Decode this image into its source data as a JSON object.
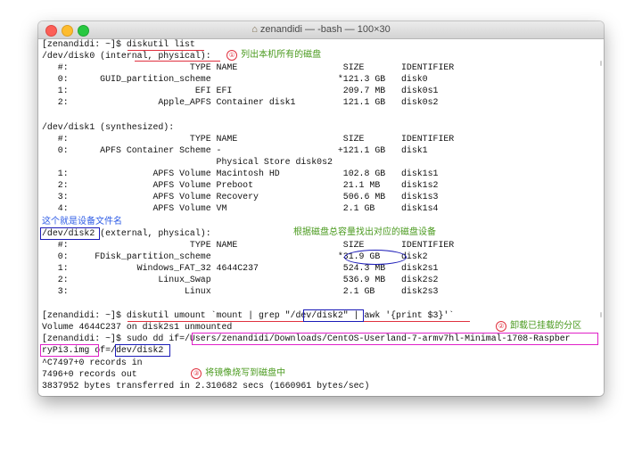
{
  "window": {
    "title": "zenandidi — -bash — 100×30"
  },
  "colors": {
    "note_red": "#e0313f",
    "note_green": "#4a9a1e",
    "note_blue": "#2e5ce6",
    "box_navy": "#1b1bb8",
    "box_magenta": "#e021c8"
  },
  "terminal": {
    "lines": [
      "[zenandidi: ~]$ diskutil list",
      "/dev/disk0 (internal, physical):",
      "   #:                       TYPE NAME                    SIZE       IDENTIFIER",
      "   0:      GUID_partition_scheme                        *121.3 GB   disk0",
      "   1:                        EFI EFI                     209.7 MB   disk0s1",
      "   2:                 Apple_APFS Container disk1         121.1 GB   disk0s2",
      "",
      "/dev/disk1 (synthesized):",
      "   #:                       TYPE NAME                    SIZE       IDENTIFIER",
      "   0:      APFS Container Scheme -                      +121.1 GB   disk1",
      "                                 Physical Store disk0s2",
      "   1:                APFS Volume Macintosh HD            102.8 GB   disk1s1",
      "   2:                APFS Volume Preboot                 21.1 MB    disk1s2",
      "   3:                APFS Volume Recovery                506.6 MB   disk1s3",
      "   4:                APFS Volume VM                      2.1 GB     disk1s4",
      "",
      "/dev/disk2 (external, physical):",
      "   #:                       TYPE NAME                    SIZE       IDENTIFIER",
      "   0:     FDisk_partition_scheme                        *31.9 GB    disk2",
      "   1:             Windows_FAT_32 4644C237                524.3 MB   disk2s1",
      "   2:                 Linux_Swap                         536.9 MB   disk2s2",
      "   3:                      Linux                         2.1 GB     disk2s3",
      "",
      "[zenandidi: ~]$ diskutil umount `mount | grep \"/dev/disk2\" | awk '{print $3}'`",
      "Volume 4644C237 on disk2s1 unmounted",
      "[zenandidi: ~]$ sudo dd if=/Users/zenandidi/Downloads/CentOS-Userland-7-armv7hl-Minimal-1708-Raspber",
      "ryPi3.img of=/dev/disk2",
      "^C7497+0 records in",
      "7496+0 records out",
      "3837952 bytes transferred in 2.310682 secs (1660961 bytes/sec)"
    ]
  },
  "annotations": {
    "step1": {
      "num": "①",
      "text": "列出本机所有的磁盘"
    },
    "device_file": {
      "text": "这个就是设备文件名"
    },
    "capacity": {
      "text": "根据磁盘总容量找出对应的磁盘设备"
    },
    "step2": {
      "num": "②",
      "text": "卸载已挂载的分区"
    },
    "step3": {
      "num": "③",
      "text": "将镜像烧写到磁盘中"
    }
  }
}
